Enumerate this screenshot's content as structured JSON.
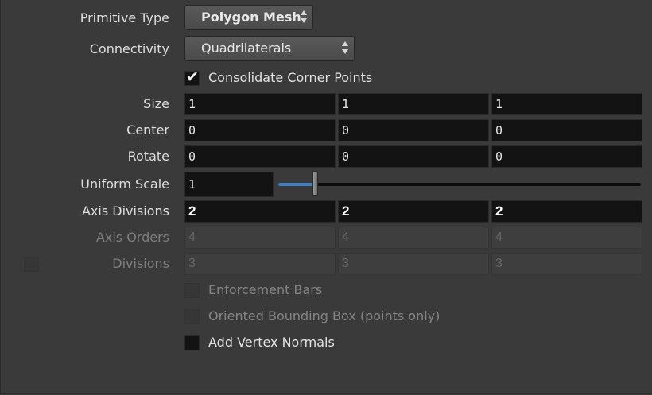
{
  "primitive_type": {
    "label": "Primitive Type",
    "value": "Polygon Mesh"
  },
  "connectivity": {
    "label": "Connectivity",
    "value": "Quadrilaterals"
  },
  "consolidate": {
    "label": "Consolidate Corner Points",
    "checked": true
  },
  "size": {
    "label": "Size",
    "values": [
      "1",
      "1",
      "1"
    ]
  },
  "center": {
    "label": "Center",
    "values": [
      "0",
      "0",
      "0"
    ]
  },
  "rotate": {
    "label": "Rotate",
    "values": [
      "0",
      "0",
      "0"
    ]
  },
  "uniform_scale": {
    "label": "Uniform Scale",
    "value": "1",
    "slider_fraction": 0.1,
    "accent": "#3f7fbf"
  },
  "axis_divisions": {
    "label": "Axis Divisions",
    "values": [
      "2",
      "2",
      "2"
    ]
  },
  "axis_orders": {
    "label": "Axis Orders",
    "values": [
      "4",
      "4",
      "4"
    ],
    "enabled": false
  },
  "divisions": {
    "label": "Divisions",
    "values": [
      "3",
      "3",
      "3"
    ],
    "enabled": false
  },
  "enforcement_bars": {
    "label": "Enforcement Bars",
    "enabled": false
  },
  "oriented_bbox": {
    "label": "Oriented Bounding Box (points only)",
    "enabled": false
  },
  "add_vertex_normals": {
    "label": "Add Vertex Normals",
    "checked": false
  }
}
